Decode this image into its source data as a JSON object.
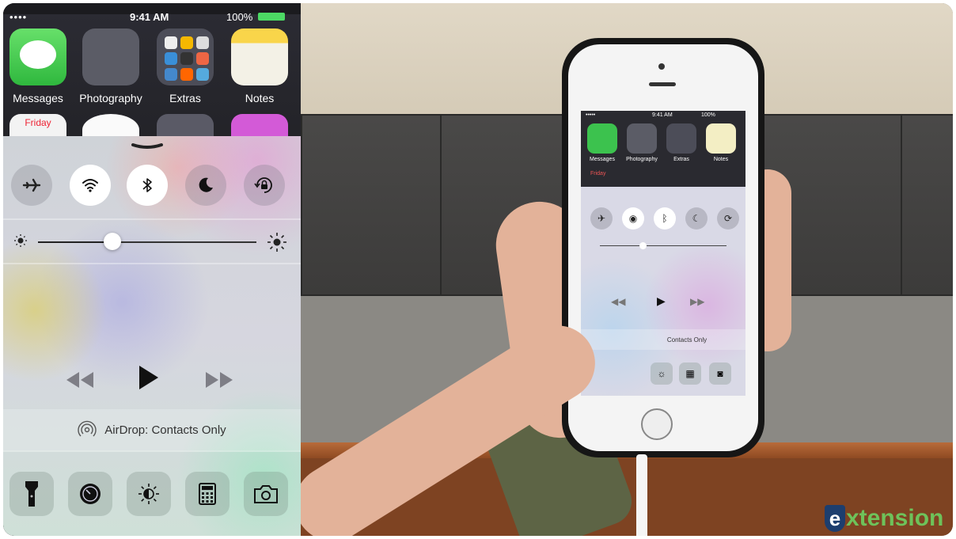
{
  "status_bar": {
    "signal": "•••• ",
    "time": "9:41 AM",
    "battery": "100%"
  },
  "home_apps": [
    {
      "label": "Messages"
    },
    {
      "label": "Photography"
    },
    {
      "label": "Extras"
    },
    {
      "label": "Notes"
    }
  ],
  "calendar_peek": "Friday",
  "control_center": {
    "toggles": [
      {
        "name": "airplane-mode",
        "state": "off"
      },
      {
        "name": "wifi",
        "state": "on"
      },
      {
        "name": "bluetooth",
        "state": "on"
      },
      {
        "name": "do-not-disturb",
        "state": "off"
      },
      {
        "name": "rotation-lock",
        "state": "off"
      }
    ],
    "brightness_level": 0.34,
    "airdrop_label": "AirDrop: Contacts Only",
    "shortcuts": [
      "flashlight",
      "timer",
      "night-shift",
      "calculator",
      "camera"
    ]
  },
  "video_phone": {
    "status_time": "9:41 AM",
    "status_battery": "100%",
    "app_labels": [
      "Messages",
      "Photography",
      "Extras",
      "Notes"
    ],
    "calendar_peek": "Friday",
    "airdrop_label": "Contacts Only"
  },
  "watermark": {
    "text": "xtension",
    "letter": "e"
  },
  "colors": {
    "accent_green": "#4cd964",
    "logo_blue": "#1d3e6e",
    "logo_green": "#6ec25a"
  }
}
